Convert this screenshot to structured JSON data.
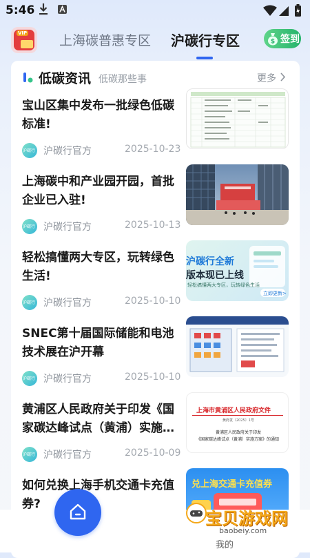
{
  "status_bar": {
    "time": "5:46"
  },
  "top_nav": {
    "tabs": [
      "上海碳普惠专区",
      "沪碳行专区"
    ],
    "active_tab": "沪碳行专区",
    "vip_tag": "VIP",
    "signin_label": "签到"
  },
  "section": {
    "title": "低碳资讯",
    "subtitle": "低碳那些事",
    "more_label": "更多"
  },
  "articles": [
    {
      "title": "宝山区集中发布一批绿色低碳标准!",
      "source": "沪碳行官方",
      "date": "2025-10-23",
      "thumb": "green-table"
    },
    {
      "title": "上海碳中和产业园开园，首批企业已入驻!",
      "source": "沪碳行官方",
      "date": "2025-10-13",
      "thumb": "building"
    },
    {
      "title": "轻松搞懂两大专区，玩转绿色生活!",
      "source": "沪碳行官方",
      "date": "2025-10-10",
      "thumb": "app-launch"
    },
    {
      "title": "SNEC第十届国际储能和电池技术展在沪开幕",
      "source": "沪碳行官方",
      "date": "2025-10-10",
      "thumb": "floor-plan"
    },
    {
      "title": "黄浦区人民政府关于印发《国家碳达峰试点（黄浦）实施…",
      "source": "沪碳行官方",
      "date": "2025-10-09",
      "thumb": "gov-document"
    },
    {
      "title": "如何兑换上海手机交通卡充值券?",
      "source": "",
      "date": "",
      "thumb": "transit-card"
    }
  ],
  "thumb_text": {
    "app_launch_title": "沪碳行全新",
    "app_launch_sub": "版本现已上线",
    "app_launch_tag": "轻松搞懂两大专区，玩转绿色生活",
    "app_launch_btn": "立即更新>",
    "gov_header": "上海市黄浦区人民政府文件",
    "gov_ref": "黄府发〔2025〕1号",
    "gov_body1": "黄浦区人民政府关于印发",
    "gov_body2": "《国家碳达峰试点（黄浦）实施方案》的通知",
    "transit_title": "兑上海交通卡充值券"
  },
  "avatar_text": "沪碳行",
  "bottom_bar": {
    "my_label": "我的"
  },
  "watermark": {
    "text": "宝贝游戏网",
    "url": "baobeiy.com"
  },
  "colors": {
    "accent": "#2f66f0",
    "signin": "#24b36b",
    "date": "#a4a9b0"
  }
}
